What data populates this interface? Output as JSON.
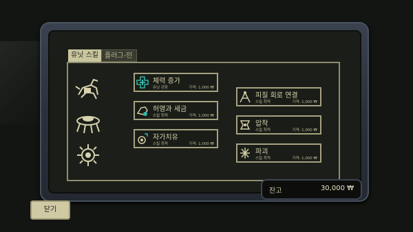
{
  "tabs": [
    {
      "label": "유닛 스킬",
      "active": true
    },
    {
      "label": "플러그-인",
      "active": false
    }
  ],
  "units": [
    {
      "icon": "scorpion-mech-icon"
    },
    {
      "icon": "saucer-walker-icon"
    },
    {
      "icon": "gear-beast-icon"
    }
  ],
  "skills_left": [
    {
      "title": "체력 증가",
      "category": "유닛 강화",
      "price": "가격: 1,000 ₩",
      "icon": "plus-cross-icon",
      "color": "#2fb8a8"
    },
    {
      "title": "허영과 세금",
      "category": "스킬 최적",
      "price": "가격: 1,000 ₩",
      "icon": "fist-coin-icon",
      "color": "#d0cca6"
    },
    {
      "title": "자가치유",
      "category": "스킬 최적",
      "price": "가격: 1,000 ₩",
      "icon": "repair-gear-icon",
      "color": "#d0cca6"
    }
  ],
  "skills_right": [
    {
      "title": "피질 회로 연결",
      "category": "스킬 최적",
      "price": "가격: 1,000 ₩",
      "icon": "circuit-icon"
    },
    {
      "title": "압착",
      "category": "스킬 최적",
      "price": "가격: 1,000 ₩",
      "icon": "crush-icon"
    },
    {
      "title": "파괴",
      "category": "스킬 최적",
      "price": "가격: 1,000 ₩",
      "icon": "shatter-icon"
    }
  ],
  "balance": {
    "label": "잔고",
    "value": "30,000 ₩"
  },
  "close_label": "닫기"
}
